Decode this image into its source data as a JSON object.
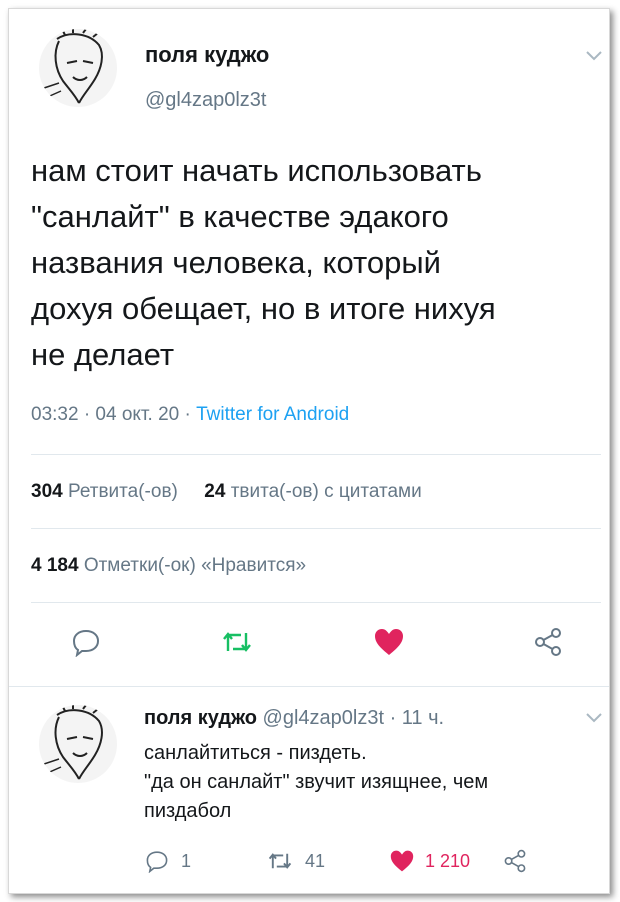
{
  "tweet": {
    "author_name": "поля куджо",
    "author_handle": "@gl4zap0lz3t",
    "text": "нам стоит начать использовать\n\"санлайт\" в качестве эдакого\nназвания человека, который\nдохуя обещает, но в итоге нихуя\nне делает",
    "time": "03:32 · 04 окт. 20 · ",
    "source": "Twitter for Android",
    "retweets_count": "304",
    "retweets_label": " Ретвита(-ов)",
    "quotes_count": "24",
    "quotes_label": " твита(-ов) с цитатами",
    "likes_count": "4 184",
    "likes_label": " Отметки(-ок) «Нравится»",
    "icons": [
      "reply-icon",
      "retweet-icon",
      "like-icon",
      "share-icon"
    ],
    "colors": {
      "retweet": "#17bf63",
      "like": "#e0245e",
      "link": "#1da1f2",
      "muted": "#657786"
    }
  },
  "reply": {
    "author_name": "поля куджо",
    "author_handle": "@gl4zap0lz3t",
    "age": " · 11 ч.",
    "text": "санлайтиться - пиздеть.\n\"да он санлайт\" звучит изящнее, чем\nпиздабол",
    "reply_count": "1",
    "retweet_count": "41",
    "like_count": "1 210",
    "liked": true
  }
}
